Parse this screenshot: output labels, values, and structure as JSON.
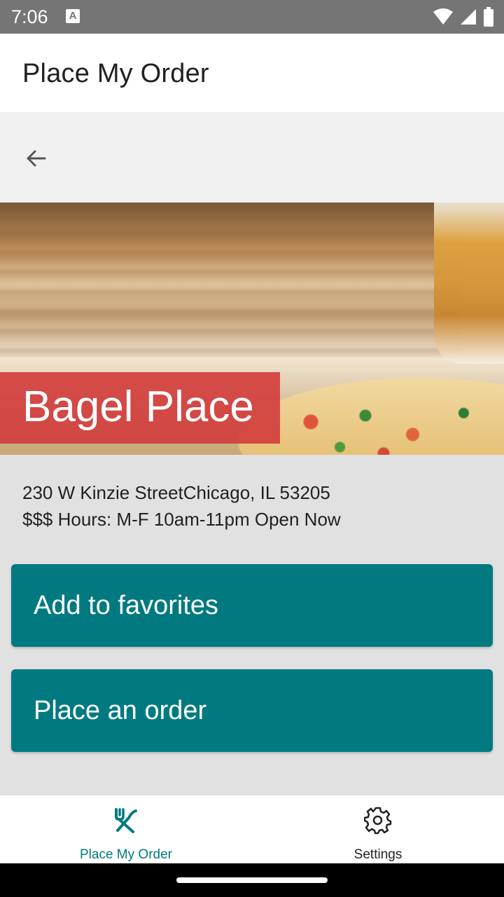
{
  "status_bar": {
    "time": "7:06",
    "notification_icon": "A"
  },
  "app_bar": {
    "title": "Place My Order"
  },
  "navigation": {
    "back_icon": "arrow-left-icon"
  },
  "restaurant": {
    "name": "Bagel Place",
    "address_line": "230 W Kinzie StreetChicago, IL 53205",
    "info_line": "$$$ Hours: M-F 10am-11pm Open Now"
  },
  "actions": {
    "add_favorites_label": "Add to favorites",
    "place_order_label": "Place an order"
  },
  "bottom_nav": {
    "items": [
      {
        "label": "Place My Order",
        "icon": "utensils-icon",
        "active": true
      },
      {
        "label": "Settings",
        "icon": "gear-icon",
        "active": false
      }
    ]
  },
  "colors": {
    "accent": "#007a80",
    "title_banner": "#d23c3c",
    "status_bar": "#757575"
  }
}
